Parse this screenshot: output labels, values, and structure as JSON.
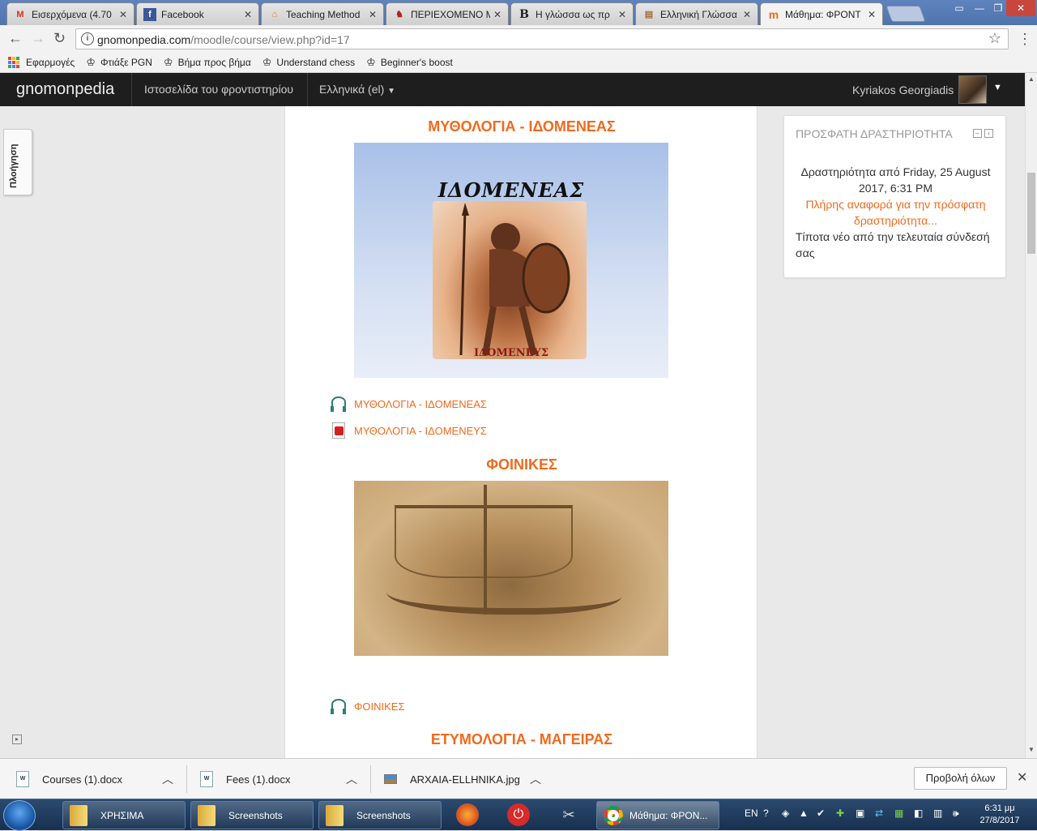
{
  "browser": {
    "tabs": [
      {
        "title": "Εισερχόμενα (4.70",
        "icon": "gmail-icon",
        "color": "#d93025",
        "glyph": "M"
      },
      {
        "title": "Facebook",
        "icon": "facebook-icon",
        "color": "#3b5998",
        "glyph": "f"
      },
      {
        "title": "Teaching Method",
        "icon": "columns-icon",
        "color": "#c77a1e",
        "glyph": "⌂"
      },
      {
        "title": "ΠΕΡΙΕΧΟΜΕΝΟ Μ",
        "icon": "helmet-icon",
        "color": "#b22222",
        "glyph": "♞"
      },
      {
        "title": "Η γλώσσα ως πρ",
        "icon": "b-icon",
        "color": "#222",
        "glyph": "B"
      },
      {
        "title": "Ελληνική Γλώσσα",
        "icon": "book-icon",
        "color": "#a0703a",
        "glyph": "▤"
      },
      {
        "title": "Μάθημα: ΦΡΟΝΤ",
        "icon": "moodle-icon",
        "color": "#f06a1d",
        "glyph": "m"
      }
    ],
    "url_host": "gnomonpedia.com",
    "url_path": "/moodle/course/view.php?id=17",
    "bookmarks": [
      {
        "label": "Εφαρμογές",
        "icon": "apps-icon"
      },
      {
        "label": "Φτιάξε PGN",
        "icon": "chess-icon"
      },
      {
        "label": "Βήμα προς βήμα",
        "icon": "chess-icon"
      },
      {
        "label": "Understand chess",
        "icon": "chess-icon"
      },
      {
        "label": "Beginner's boost",
        "icon": "chess-icon"
      }
    ]
  },
  "navbar": {
    "brand": "gnomonpedia",
    "site_link": "Ιστοσελίδα του φροντιστηρίου",
    "language": "Ελληνικά (el)",
    "user": "Kyriakos Georgiadis"
  },
  "drawer_tab": "Πλοήγηση",
  "sections": {
    "s1_title": "ΜΥΘΟΛΟΓΙΑ - ΙΔΟΜΕΝΕΑΣ",
    "s1_image_title": "ΙΔΟΜΕΝΕΑΣ",
    "s1_image_caption": "ΙΔΟΜΕΝΕΥΣ",
    "s1_res1": "ΜΥΘΟΛΟΓΙΑ - ΙΔΟΜΕΝΕΑΣ",
    "s1_res2": "ΜΥΘΟΛΟΓΙΑ - ΙΔΟΜΕΝΕΥΣ",
    "s2_title": "ΦΟΙΝΙΚΕΣ",
    "s2_res1": "ΦΟΙΝΙΚΕΣ",
    "s3_title": "ΕΤΥΜΟΛΟΓΙΑ - ΜΑΓΕΙΡΑΣ"
  },
  "recent_block": {
    "title": "ΠΡΟΣΦΑΤΗ ΔΡΑΣΤΗΡΙΟΤΗΤΑ",
    "since_line1": "Δραστηριότητα από Friday, 25 August",
    "since_line2": "2017, 6:31 PM",
    "report_line1": "Πλήρης αναφορά για την πρόσφατη",
    "report_line2": "δραστηριότητα...",
    "nothing": "Τίποτα νέο από την τελευταία σύνδεσή σας"
  },
  "downloads": {
    "items": [
      {
        "name": "Courses (1).docx",
        "icon": "word-icon"
      },
      {
        "name": "Fees (1).docx",
        "icon": "word-icon"
      },
      {
        "name": "ARXAIA-ELLHNIKA.jpg",
        "icon": "image-icon"
      }
    ],
    "show_all": "Προβολή όλων"
  },
  "taskbar": {
    "items": [
      "ΧΡΗΣΙΜΑ",
      "Screenshots",
      "Screenshots",
      "Μάθημα: ΦΡΟΝ..."
    ],
    "lang": "EN",
    "time": "6:31 μμ",
    "date": "27/8/2017"
  },
  "colors": {
    "accent": "#f06a1d",
    "navbar": "#1e1e1e"
  }
}
